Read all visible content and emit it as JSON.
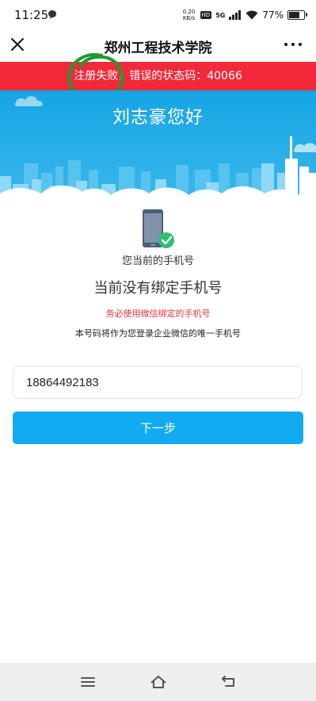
{
  "status_bar": {
    "time": "11:25",
    "net_speed_value": "0.20",
    "net_speed_unit": "KB/s",
    "hd_badge": "HD",
    "network": "5G",
    "battery": "77%",
    "battery_level": 0.77,
    "icons": [
      "message-icon",
      "signal-icon",
      "wifi-icon",
      "battery-icon"
    ]
  },
  "header": {
    "title": "郑州工程技术学院",
    "left_icon": "close-icon",
    "right_icon": "more-icon"
  },
  "error_banner": {
    "text": "注册失败，错误的状态码：40066",
    "color": "#f2293a"
  },
  "hero": {
    "greeting": "刘志豪您好",
    "color": "#16a5e4"
  },
  "content": {
    "phone_icon": "phone-check-icon",
    "current_phone_label": "您当前的手机号",
    "no_phone_title": "当前没有绑定手机号",
    "warning_note": "务必使用微信绑定的手机号",
    "description": "本号码将作为您登录企业微信的唯一手机号"
  },
  "phone_input": {
    "value": "18864492183",
    "placeholder": ""
  },
  "next_button": {
    "label": "下一步",
    "color": "#12aaf0"
  },
  "nav_bar": {
    "icons": [
      "menu-icon",
      "home-icon",
      "back-icon"
    ]
  }
}
